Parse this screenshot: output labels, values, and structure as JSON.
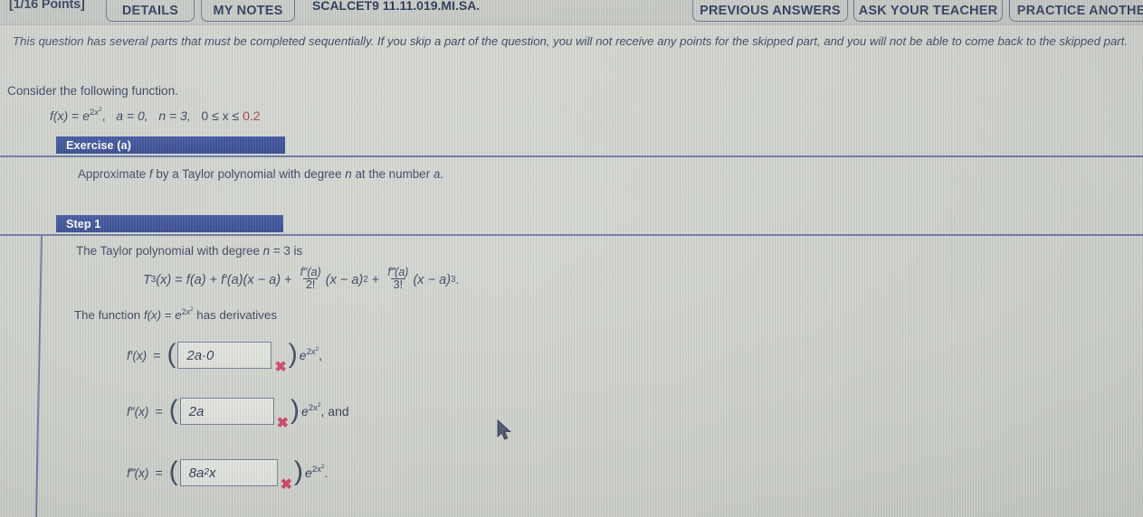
{
  "header": {
    "points_label": "[1/16 Points]",
    "details_button": "DETAILS",
    "my_notes_button": "MY NOTES",
    "assignment_code": "SCALCET9 11.11.019.MI.SA.",
    "previous_answers_button": "PREVIOUS ANSWERS",
    "ask_teacher_button": "ASK YOUR TEACHER",
    "practice_another_button": "PRACTICE ANOTHER"
  },
  "notice": "This question has several parts that must be completed sequentially. If you skip a part of the question, you will not receive any points for the skipped part, and you will not be able to come back to the skipped part.",
  "problem": {
    "consider_text": "Consider the following function.",
    "function": {
      "f_of_x": "f(x)",
      "equals": "=",
      "base": "e",
      "exponent_coefficient": "2",
      "exponent_variable": "x",
      "exponent_power": "2",
      "comma": ",",
      "a_value": "a = 0,",
      "n_value": "n = 3,",
      "domain_prefix": "0 ≤ x ≤",
      "domain_max": "0.2",
      "domain_max_color": "#a32c2c"
    }
  },
  "exercise": {
    "bar_label": "Exercise (a)",
    "instruction": "Approximate f by a Taylor polynomial with degree n at the number a.",
    "bar_color": "#23398c"
  },
  "step1": {
    "bar_label": "Step 1",
    "intro": "The Taylor polynomial with degree n = 3 is",
    "taylor_formula": {
      "lhs": "T",
      "lhs_sub": "3",
      "lhs_arg": "(x)",
      "eq": "=",
      "term1": "f(a)",
      "plus1": "+",
      "term2": "f′(a)(x − a)",
      "plus2": "+",
      "frac1_num": "f″(a)",
      "frac1_den": "2!",
      "term3": "(x − a)",
      "term3_pow": "2",
      "plus3": "+",
      "frac2_num": "f‴(a)",
      "frac2_den": "3!",
      "term4": "(x − a)",
      "term4_pow": "3",
      "period": "."
    },
    "derivatives_intro_prefix": "The function ",
    "derivatives_intro_fn": "f(x)",
    "derivatives_intro_eq": " = ",
    "derivatives_intro_suffix": " has derivatives",
    "rows": [
      {
        "label": "f′(x)",
        "equals": "=",
        "open_paren": "(",
        "answer_value": "2a·0",
        "status_icon": "x-mark-incorrect",
        "close_paren": ")",
        "tail_base": "e",
        "tail_exp": "2x",
        "tail_exp_pow": "2",
        "tail_suffix": ","
      },
      {
        "label": "f″(x)",
        "equals": "=",
        "open_paren": "(",
        "answer_value": "2a",
        "status_icon": "x-mark-incorrect",
        "close_paren": ")",
        "tail_base": "e",
        "tail_exp": "2x",
        "tail_exp_pow": "2",
        "tail_suffix": ", and"
      },
      {
        "label": "f‴(x)",
        "equals": "=",
        "open_paren": "(",
        "answer_value": "8a",
        "answer_value_pow": "2",
        "answer_value_tail": "x",
        "status_icon": "x-mark-incorrect",
        "close_paren": ")",
        "tail_base": "e",
        "tail_exp": "2x",
        "tail_exp_pow": "2",
        "tail_suffix": "."
      }
    ]
  },
  "colors": {
    "section_bar": "#23398c",
    "divider": "#5c6a9e",
    "text": "#23314f",
    "incorrect_mark": "#c7395c",
    "highlight_red": "#a32c2c",
    "page_background": "#cfd2cb"
  }
}
